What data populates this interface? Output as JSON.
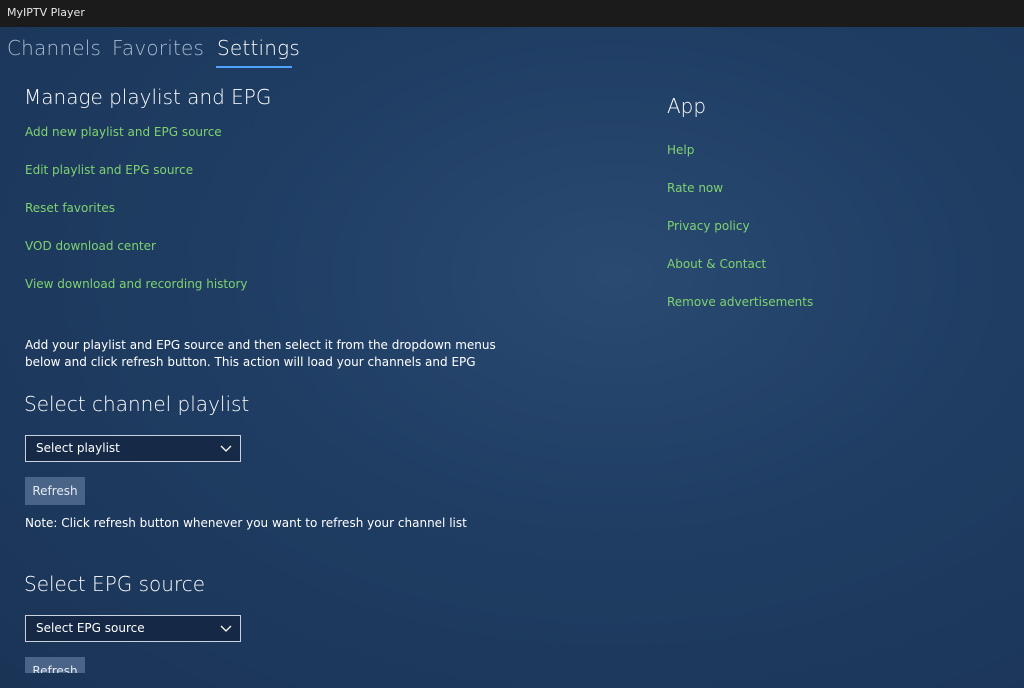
{
  "window": {
    "title": "MyIPTV Player"
  },
  "tabs": [
    {
      "label": "Channels",
      "active": false
    },
    {
      "label": "Favorites",
      "active": false
    },
    {
      "label": "Settings",
      "active": true
    }
  ],
  "manage": {
    "heading": "Manage playlist and EPG",
    "links": [
      "Add new playlist and EPG source",
      "Edit playlist and EPG source",
      "Reset favorites",
      "VOD download center",
      "View download and recording history"
    ],
    "instructions_line1": "Add your playlist and EPG source and then select it from the dropdown menus",
    "instructions_line2": "below and click refresh button. This action will load your channels and EPG"
  },
  "channel_playlist": {
    "heading": "Select channel playlist",
    "dropdown_value": "Select playlist",
    "refresh_label": "Refresh",
    "note": "Note: Click refresh button whenever you want to refresh your channel list"
  },
  "epg": {
    "heading": "Select EPG source",
    "dropdown_value": "Select EPG source",
    "refresh_label": "Refresh"
  },
  "app": {
    "heading": "App",
    "links": [
      "Help",
      "Rate now",
      "Privacy policy",
      "About & Contact",
      "Remove advertisements"
    ]
  },
  "colors": {
    "link": "#7fd36f",
    "accent": "#4fa3ff",
    "background": "#1f3d63",
    "button": "#4a6488"
  },
  "icons": {
    "dropdown_chevron": "chevron-down-icon"
  }
}
